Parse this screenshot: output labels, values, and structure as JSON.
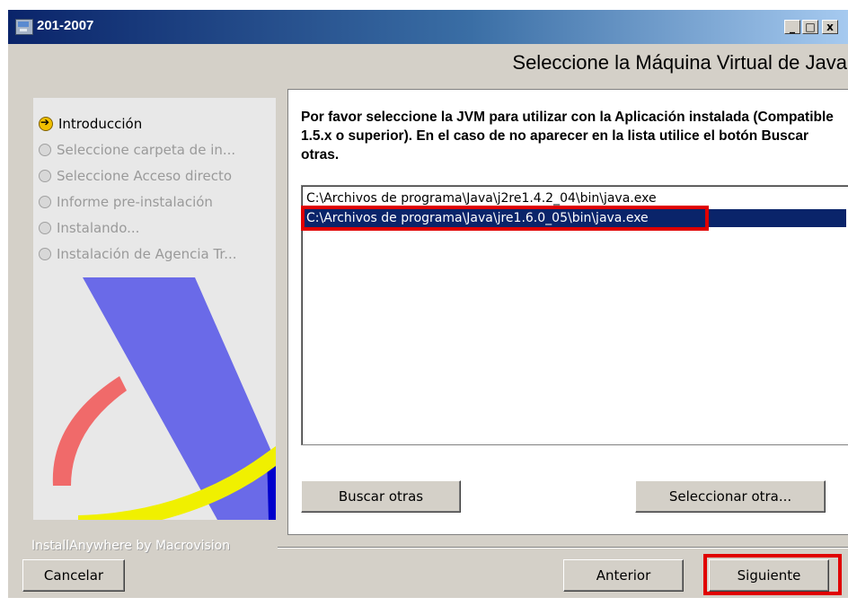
{
  "window": {
    "title": "201-2007",
    "heading": "Seleccione la Máquina Virtual de  Java",
    "minimize_glyph": "_",
    "maximize_glyph": "□",
    "close_glyph": "x"
  },
  "steps": [
    {
      "label": "Introducción",
      "state": "current"
    },
    {
      "label": "Seleccione carpeta de in...",
      "state": "pending"
    },
    {
      "label": "Seleccione  Acceso directo",
      "state": "pending"
    },
    {
      "label": "Informe pre-instalación",
      "state": "pending"
    },
    {
      "label": "Instalando...",
      "state": "pending"
    },
    {
      "label": "Instalación de Agencia Tr...",
      "state": "pending"
    }
  ],
  "content": {
    "instructions": "Por favor seleccione la JVM para utilizar con la Aplicación instalada (Compatible 1.5.x o superior). En el caso de no aparecer en la lista utilice el botón Buscar otras.",
    "jvm_list": [
      "C:\\Archivos de programa\\Java\\j2re1.4.2_04\\bin\\java.exe",
      "C:\\Archivos de programa\\Java\\jre1.6.0_05\\bin\\java.exe"
    ],
    "selected_index": 1,
    "search_button": "Buscar otras",
    "select_other_button": "Seleccionar otra..."
  },
  "footer": {
    "brand": "InstallAnywhere by Macrovision",
    "cancel_button": "Cancelar",
    "back_button": "Anterior",
    "next_button": "Siguiente"
  },
  "colors": {
    "titlebar_start": "#0a246a",
    "titlebar_end": "#a6caf0",
    "selection": "#0a246a",
    "highlight_box": "#e00000",
    "dialog_face": "#d4d0c8"
  }
}
